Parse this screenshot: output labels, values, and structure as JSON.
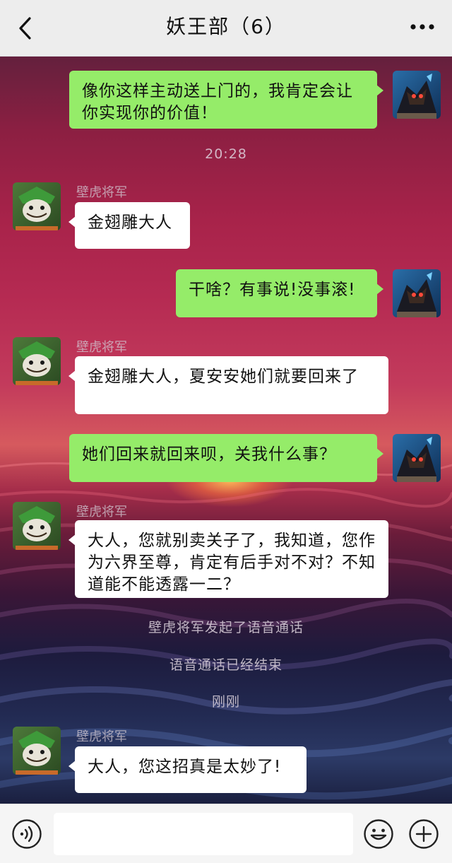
{
  "header": {
    "title": "妖王部（6）",
    "back_icon": "chevron-left-icon",
    "more_icon": "more-dots-icon"
  },
  "contact": {
    "name": "壁虎将军"
  },
  "messages": [
    {
      "from": "me",
      "text": "像你这样主动送上门的，我肯定会让你实现你的价值！"
    },
    {
      "from": "system",
      "text": "20:28"
    },
    {
      "from": "other",
      "sender": "壁虎将军",
      "text": "金翅雕大人"
    },
    {
      "from": "me",
      "text": "干啥？有事说!没事滚!"
    },
    {
      "from": "other",
      "sender": "壁虎将军",
      "text": "金翅雕大人，夏安安她们就要回来了"
    },
    {
      "from": "me",
      "text": "她们回来就回来呗，关我什么事？"
    },
    {
      "from": "other",
      "sender": "壁虎将军",
      "text": "大人，您就别卖关子了，我知道，您作为六界至尊，肯定有后手对不对？不知道能不能透露一二？"
    },
    {
      "from": "system",
      "text": "壁虎将军发起了语音通话"
    },
    {
      "from": "system",
      "text": "语音通话已经结束"
    },
    {
      "from": "system",
      "text": "刚刚"
    },
    {
      "from": "other",
      "sender": "壁虎将军",
      "text": "大人，您这招真是太妙了!"
    }
  ],
  "input_bar": {
    "placeholder": "",
    "voice_icon": "voice-icon",
    "emoji_icon": "emoji-icon",
    "plus_icon": "plus-icon"
  },
  "colors": {
    "header_bg": "#ededed",
    "my_bubble": "#95ec69",
    "other_bubble": "#ffffff"
  }
}
